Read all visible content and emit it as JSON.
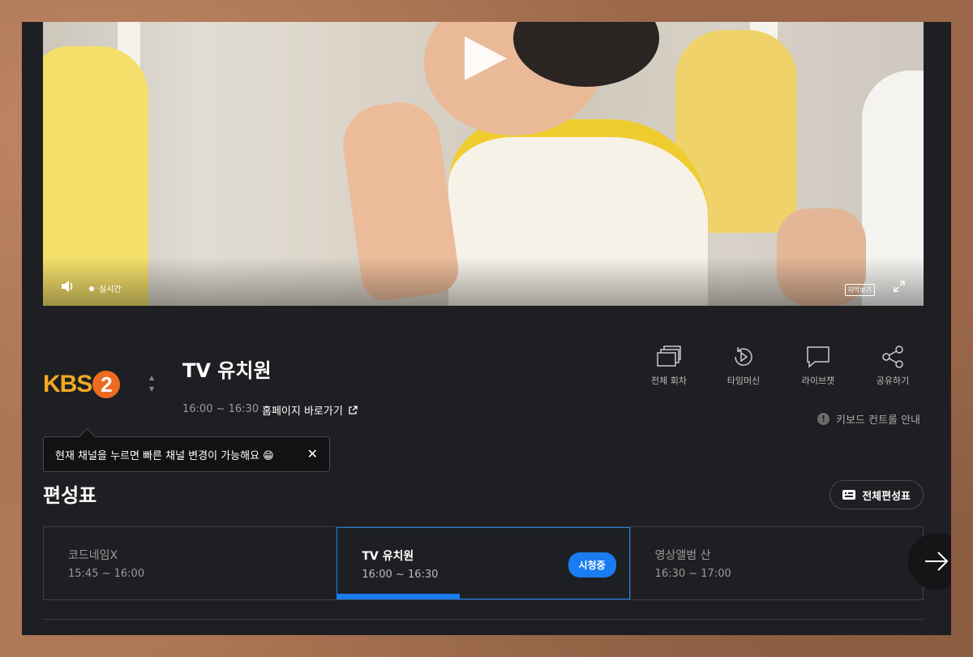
{
  "player": {
    "live_label": "실시간",
    "subtitle_label": "자막보기",
    "icons": [
      "play-icon",
      "volume-icon",
      "fullscreen-icon"
    ]
  },
  "channel": {
    "logo_text": "KBS",
    "logo_number": "2",
    "program_title": "TV 유치원",
    "time_range": "16:00 ~ 16:30",
    "homepage_link": "홈페이지 바로가기"
  },
  "actions": [
    {
      "label": "전체 회차",
      "icon": "episodes-icon"
    },
    {
      "label": "타임머신",
      "icon": "timemachine-icon"
    },
    {
      "label": "라이브챗",
      "icon": "chat-icon"
    },
    {
      "label": "공유하기",
      "icon": "share-icon"
    }
  ],
  "keyboard_guide": "키보드 컨트롤 안내",
  "tooltip": {
    "text": "현재 채널을 누르면 빠른 채널 변경이 가능해요 😁"
  },
  "schedule": {
    "title": "편성표",
    "full_button": "전체편성표",
    "items": [
      {
        "name": "코드네임X",
        "time": "15:45 ~ 16:00"
      },
      {
        "name": "TV 유치원",
        "time": "16:00 ~ 16:30",
        "badge": "시청중",
        "progress": 0.42
      },
      {
        "name": "영상앨범 산",
        "time": "16:30 ~ 17:00"
      }
    ]
  },
  "colors": {
    "accent": "#1a7cf1",
    "logo_orange": "#f2a823",
    "background": "#1e1f22"
  }
}
